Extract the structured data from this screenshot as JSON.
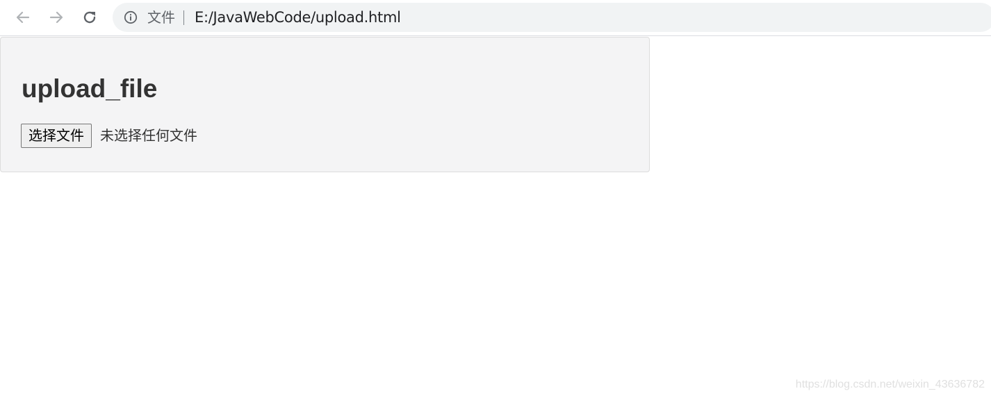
{
  "browser": {
    "nav": {
      "back_icon": "arrow-left-icon",
      "forward_icon": "arrow-right-icon",
      "reload_icon": "reload-icon"
    },
    "address_bar": {
      "info_icon": "info-icon",
      "scheme_label": "文件",
      "url": "E:/JavaWebCode/upload.html"
    }
  },
  "page": {
    "title": "upload_file",
    "file_input": {
      "button_label": "选择文件",
      "status_text": "未选择任何文件"
    }
  },
  "watermark": "https://blog.csdn.net/weixin_43636782",
  "colors": {
    "toolbar_bg": "#ffffff",
    "omnibox_bg": "#f1f3f4",
    "panel_bg": "#f4f4f5",
    "panel_border": "#dcdcdc",
    "title_color": "#333333",
    "nav_icon_disabled": "#b0b3b6",
    "nav_icon_enabled": "#5f6368"
  }
}
